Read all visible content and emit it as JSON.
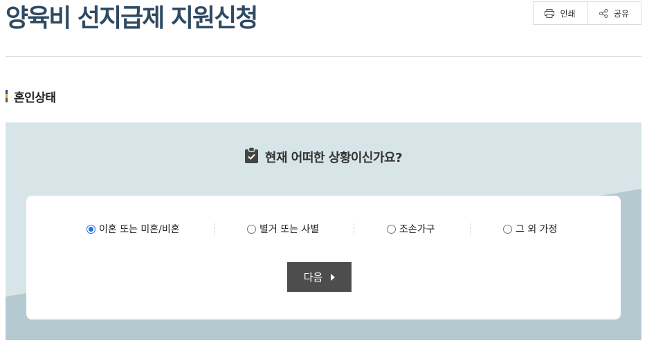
{
  "page": {
    "title": "양육비 선지급제 지원신청"
  },
  "tools": {
    "print_label": "인쇄",
    "share_label": "공유",
    "print_icon": "printer-icon",
    "share_icon": "share-icon"
  },
  "section": {
    "title": "혼인상태",
    "marker_colors": [
      "#2d4aa3",
      "#e8a21b",
      "#555555"
    ]
  },
  "question": {
    "text": "현재 어떠한 상황이신가요?",
    "icon": "clipboard-check-icon"
  },
  "options": [
    {
      "label": "이혼 또는 미혼/비혼",
      "checked": true
    },
    {
      "label": "별거 또는 사별",
      "checked": false
    },
    {
      "label": "조손가구",
      "checked": false
    },
    {
      "label": "그 외 가정",
      "checked": false
    }
  ],
  "next_button": {
    "label": "다음",
    "icon": "caret-right-icon"
  },
  "colors": {
    "title": "#2f4a63",
    "panel_bg": "#d8e5e8",
    "panel_accent": "#b5c9d0",
    "button_bg": "#4d4d4d",
    "radio_accent": "#1a73e8"
  }
}
